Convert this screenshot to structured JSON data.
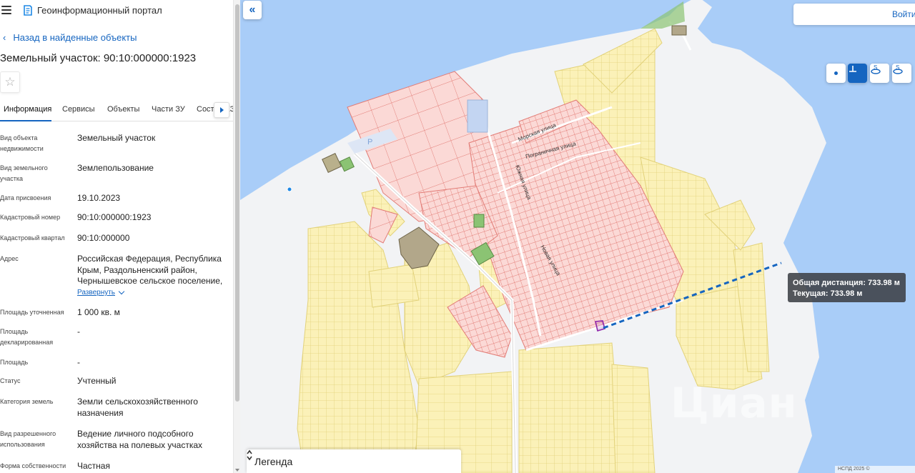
{
  "header": {
    "app_title": "Геоинформационный портал"
  },
  "nav": {
    "back_label": "Назад в найденные объекты"
  },
  "object": {
    "title": "Земельный участок: 90:10:000000:1923"
  },
  "tabs": [
    {
      "label": "Информация",
      "active": true
    },
    {
      "label": "Сервисы",
      "active": false
    },
    {
      "label": "Объекты",
      "active": false
    },
    {
      "label": "Части ЗУ",
      "active": false
    },
    {
      "label": "Состав ЕЗП",
      "active": false
    }
  ],
  "properties": [
    {
      "label": "Вид объекта недвижимости",
      "value": "Земельный участок"
    },
    {
      "label": "Вид земельного участка",
      "value": "Землепользование"
    },
    {
      "label": "Дата присвоения",
      "value": "19.10.2023"
    },
    {
      "label": "Кадастровый номер",
      "value": "90:10:000000:1923"
    },
    {
      "label": "Кадастровый квартал",
      "value": "90:10:000000"
    },
    {
      "label": "Адрес",
      "value": "Российская Федерация, Республика Крым, Раздольненский район, Чернышевское сельское поселение,"
    },
    {
      "label": "Площадь уточненная",
      "value": "1 000 кв. м"
    },
    {
      "label": "Площадь декларированная",
      "value": "-"
    },
    {
      "label": "Площадь",
      "value": "-"
    },
    {
      "label": "Статус",
      "value": "Учтенный"
    },
    {
      "label": "Категория земель",
      "value": "Земли сельскохозяйственного назначения"
    },
    {
      "label": "Вид разрешенного использования",
      "value": "Ведение личного подсобного хозяйства на полевых участках"
    },
    {
      "label": "Форма собственности",
      "value": "Частная"
    }
  ],
  "expand_label": "Развернуть",
  "map": {
    "login_label": "Войти",
    "tooltip": {
      "total_label": "Общая дистанция: 733.98 м",
      "current_label": "Текущая: 733.98 м"
    },
    "legend_label": "Легенда",
    "watermark": "Циан",
    "attribution": "НСПД 2025 ©",
    "street_labels": [
      "Морская улица",
      "Пограничная улица",
      "Южная улица",
      "Новая улица"
    ],
    "parking_label": "P",
    "colors": {
      "water": "#a9cdf8",
      "land": "#f2f3f5",
      "parcel_yellow": "#fbf1b8",
      "parcel_yellow_stroke": "#e2d27a",
      "parcel_red": "#fbd9d6",
      "parcel_red_stroke": "#e27c76",
      "measure_line": "#1565c0",
      "selected_parcel": "#8e24aa"
    }
  },
  "icons": {
    "menu": "menu-icon",
    "logo": "portal-logo-icon",
    "back": "chevron-left-icon",
    "star": "star-icon",
    "tab_next": "chevron-right-icon",
    "expand": "chevron-down-icon",
    "collapse": "double-chevron-left-icon",
    "tools": [
      "point-measure-icon",
      "distance-measure-icon",
      "area-measure-icon",
      "perimeter-measure-icon"
    ],
    "legend_toggle": "up-down-icon"
  }
}
